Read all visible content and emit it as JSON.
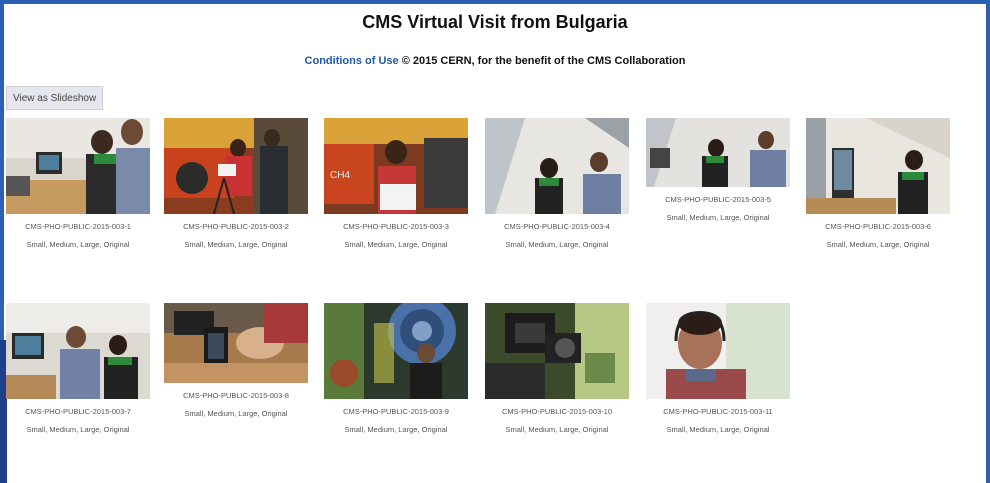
{
  "page": {
    "title": "CMS Virtual Visit from Bulgaria",
    "conditions_link": "Conditions of Use",
    "copyright": "© 2015 CERN, for the benefit of the CMS Collaboration"
  },
  "toolbar": {
    "slideshow_label": "View as Slideshow"
  },
  "photos": [
    {
      "id": "CMS-PHO-PUBLIC-2015-003-1",
      "sizes": "Small, Medium, Large, Original",
      "scene": "office-desk"
    },
    {
      "id": "CMS-PHO-PUBLIC-2015-003-2",
      "sizes": "Small, Medium, Large, Original",
      "scene": "forklift-crew"
    },
    {
      "id": "CMS-PHO-PUBLIC-2015-003-3",
      "sizes": "Small, Medium, Large, Original",
      "scene": "forklift-presenter"
    },
    {
      "id": "CMS-PHO-PUBLIC-2015-003-4",
      "sizes": "Small, Medium, Large, Original",
      "scene": "office-pair"
    },
    {
      "id": "CMS-PHO-PUBLIC-2015-003-5",
      "sizes": "Small, Medium, Large, Original",
      "scene": "office-pair-wide"
    },
    {
      "id": "CMS-PHO-PUBLIC-2015-003-6",
      "sizes": "Small, Medium, Large, Original",
      "scene": "office-screen"
    },
    {
      "id": "CMS-PHO-PUBLIC-2015-003-7",
      "sizes": "Small, Medium, Large, Original",
      "scene": "office-laptop"
    },
    {
      "id": "CMS-PHO-PUBLIC-2015-003-8",
      "sizes": "Small, Medium, Large, Original",
      "scene": "camera-hands"
    },
    {
      "id": "CMS-PHO-PUBLIC-2015-003-9",
      "sizes": "Small, Medium, Large, Original",
      "scene": "detector-person"
    },
    {
      "id": "CMS-PHO-PUBLIC-2015-003-10",
      "sizes": "Small, Medium, Large, Original",
      "scene": "camera-closeup"
    },
    {
      "id": "CMS-PHO-PUBLIC-2015-003-11",
      "sizes": "Small, Medium, Large, Original",
      "scene": "headset-man"
    }
  ],
  "colors": {
    "frame": "#2d5fb5",
    "link": "#1f5aa6"
  }
}
